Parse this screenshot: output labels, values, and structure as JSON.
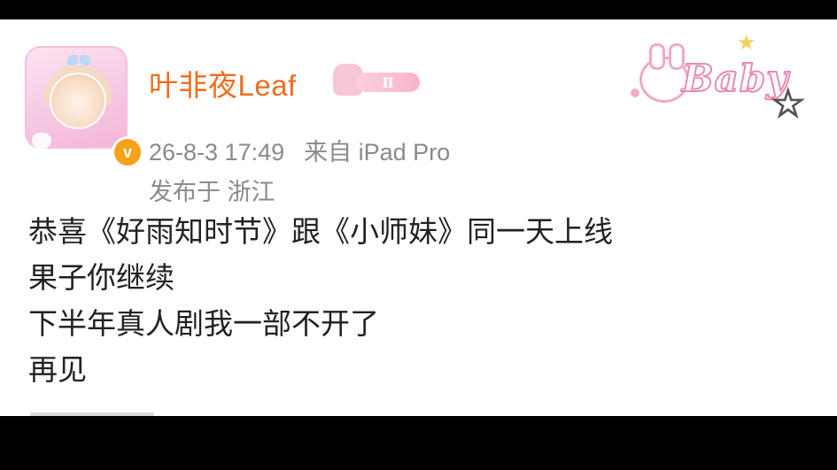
{
  "post": {
    "username": "叶非夜Leaf",
    "rank_badge": "Ⅱ",
    "timestamp": "26-8-3 17:49",
    "source": "来自 iPad Pro",
    "location": "发布于 浙江",
    "lines": [
      "恭喜《好雨知时节》跟《小师妹》同一天上线",
      "果子你继续",
      "下半年真人剧我一部不开了",
      "再见"
    ]
  },
  "decoration": {
    "word": "Baby"
  },
  "icons": {
    "verified": "v-verified-icon",
    "star": "star-icon"
  },
  "colors": {
    "username": "#ee6d1d",
    "meta": "#8a8a8a",
    "verified": "#f7a11a",
    "text": "#222222"
  }
}
